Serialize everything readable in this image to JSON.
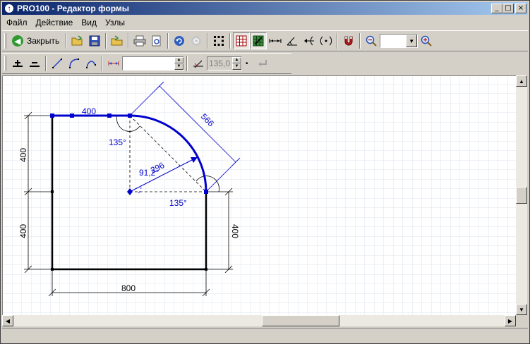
{
  "window": {
    "title": "PRO100 - Редактор формы",
    "icon_letter": "↑",
    "minimize": "_",
    "maximize": "□",
    "close": "×"
  },
  "menu": [
    "Файл",
    "Действие",
    "Вид",
    "Узлы"
  ],
  "toolbar1": {
    "close_label": "Закрыть",
    "zoom_value": ""
  },
  "toolbar2": {
    "length_value": "",
    "angle_value": "135,0",
    "angle_suffix": "•"
  },
  "drawing": {
    "labels": {
      "top_edge": "400",
      "diagonal": "566",
      "left_upper": "400",
      "left_lower": "400",
      "right": "400",
      "bottom": "800",
      "angle_top": "135°",
      "angle_right": "135°",
      "radius": "296",
      "angle_center": "91,2°"
    }
  },
  "colors": {
    "shape": "#000000",
    "selected": "#0000cc",
    "dimension": "#000000",
    "grid": "#dde6ee"
  }
}
